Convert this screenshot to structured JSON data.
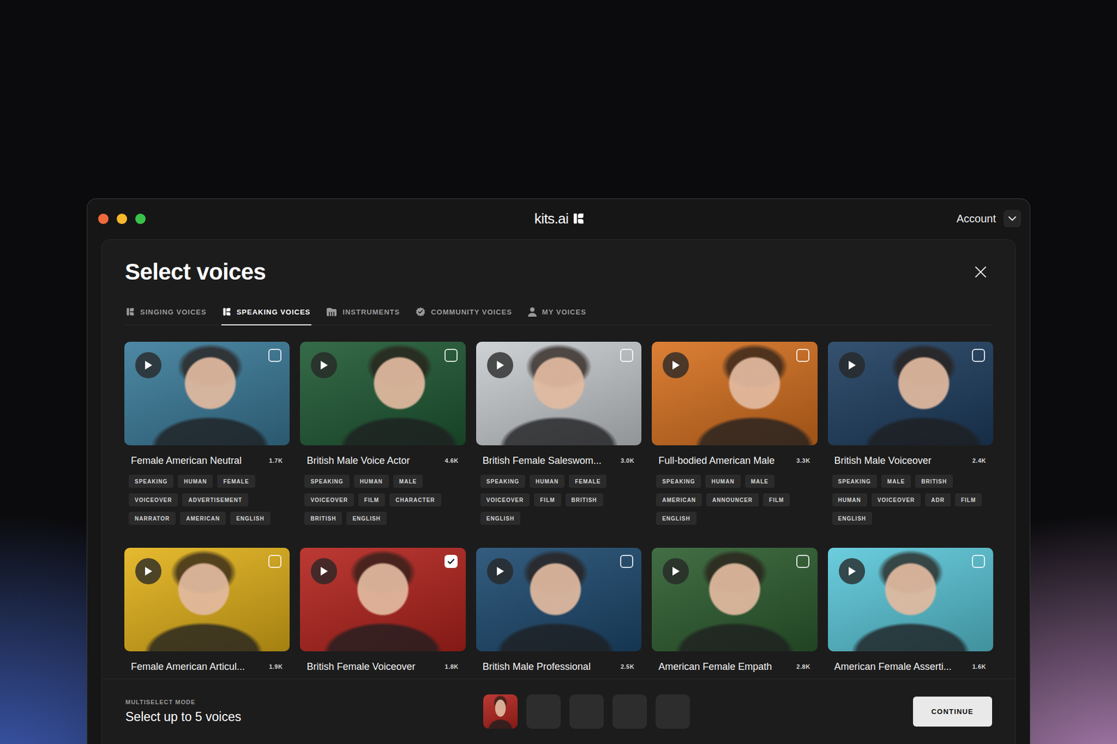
{
  "window": {
    "title": "kits.ai",
    "account": "Account"
  },
  "dialog": {
    "title": "Select voices"
  },
  "tabs": [
    {
      "label": "SINGING VOICES",
      "selected": false
    },
    {
      "label": "SPEAKING VOICES",
      "selected": true
    },
    {
      "label": "INSTRUMENTS",
      "selected": false
    },
    {
      "label": "COMMUNITY VOICES",
      "selected": false
    },
    {
      "label": "MY VOICES",
      "selected": false
    }
  ],
  "voices": [
    {
      "name": "Female American Neutral",
      "count": "1.7K",
      "checked": false,
      "color": "#3a7b9a",
      "tags": [
        "SPEAKING",
        "HUMAN",
        "FEMALE",
        "VOICEOVER",
        "ADVERTISEMENT",
        "NARRATOR",
        "AMERICAN",
        "ENGLISH"
      ]
    },
    {
      "name": "British Male Voice Actor",
      "count": "4.6K",
      "checked": false,
      "color": "#1f5a34",
      "tags": [
        "SPEAKING",
        "HUMAN",
        "MALE",
        "VOICEOVER",
        "FILM",
        "CHARACTER",
        "BRITISH",
        "ENGLISH"
      ]
    },
    {
      "name": "British Female Saleswom...",
      "count": "3.0K",
      "checked": false,
      "color": "#c9cdd0",
      "tags": [
        "SPEAKING",
        "HUMAN",
        "FEMALE",
        "VOICEOVER",
        "FILM",
        "BRITISH",
        "ENGLISH"
      ]
    },
    {
      "name": "Full-bodied American Male",
      "count": "3.3K",
      "checked": false,
      "color": "#d8711f",
      "tags": [
        "SPEAKING",
        "HUMAN",
        "MALE",
        "AMERICAN",
        "ANNOUNCER",
        "FILM",
        "ENGLISH"
      ]
    },
    {
      "name": "British Male Voiceover",
      "count": "2.4K",
      "checked": false,
      "color": "#1e3e60",
      "tags": [
        "SPEAKING",
        "MALE",
        "BRITISH",
        "HUMAN",
        "VOICEOVER",
        "ADR",
        "FILM",
        "ENGLISH"
      ]
    },
    {
      "name": "Female American Articul...",
      "count": "1.9K",
      "checked": false,
      "color": "#e3b218"
    },
    {
      "name": "British Female Voiceover",
      "count": "1.8K",
      "checked": true,
      "color": "#b5231d"
    },
    {
      "name": "British Male Professional",
      "count": "2.5K",
      "checked": false,
      "color": "#1d4a70"
    },
    {
      "name": "American Female Empath",
      "count": "2.8K",
      "checked": false,
      "color": "#2d5e2f"
    },
    {
      "name": "American Female Asserti...",
      "count": "1.6K",
      "checked": false,
      "color": "#5ac8da"
    }
  ],
  "footer": {
    "mode_label": "MULTISELECT MODE",
    "instruction": "Select up to 5 voices",
    "slots": [
      {
        "filled": true,
        "color": "#b5231d"
      },
      {
        "filled": false
      },
      {
        "filled": false
      },
      {
        "filled": false
      },
      {
        "filled": false
      }
    ],
    "button": "CONTINUE"
  }
}
